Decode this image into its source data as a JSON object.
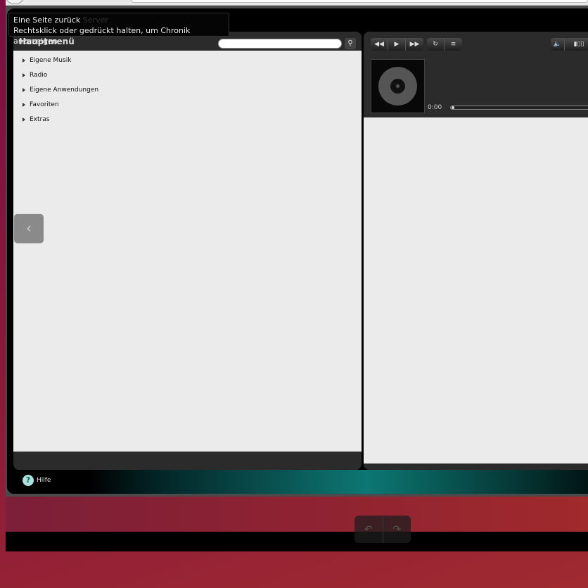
{
  "tooltip": {
    "line1": "Eine Seite zurück",
    "ghost": "Server",
    "line2": "Rechtsklick oder gedrückt halten, um Chronik anzuzeigen"
  },
  "main_menu": {
    "title": "Hauptmenü",
    "search_placeholder": "",
    "items": [
      {
        "label": "Eigene Musik"
      },
      {
        "label": "Radio"
      },
      {
        "label": "Eigene Anwendungen"
      },
      {
        "label": "Favoriten"
      },
      {
        "label": "Extras"
      }
    ]
  },
  "player": {
    "time": "0:00",
    "progress": 0
  },
  "footer": {
    "help_label": "Hilfe"
  },
  "colors": {
    "accent": "#0d7773"
  }
}
